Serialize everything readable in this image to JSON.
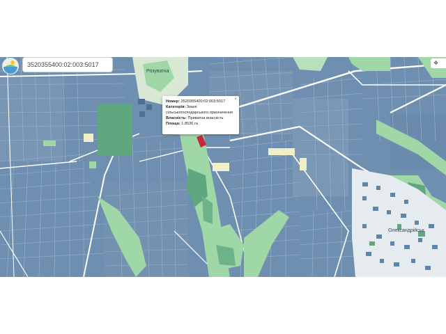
{
  "search": {
    "value": "3520355400:02:003:5017"
  },
  "popup": {
    "number_label": "Номер:",
    "number_value": "3520355400:02:003:5017",
    "category_label": "Категорія:",
    "category_value_1": "Землі",
    "category_value_2": "сільськогосподарського призначення",
    "ownership_label": "Власність:",
    "ownership_value": "Приватна власність",
    "area_label": "Площа:",
    "area_value": "1.8536 га",
    "close_glyph": "×"
  },
  "map_labels": {
    "village": "Розуватка",
    "town": "Олександрійськ"
  },
  "controls": {
    "layers_glyph": "❖"
  },
  "colors": {
    "parcel_blue": "#6f8fb0",
    "parcel_light": "#7f9dbb",
    "road": "#ffffff",
    "green": "#9fd8a6",
    "green_dark": "#5fa77e",
    "selected_parcel": "#c8283c",
    "yellow": "#f1efc8",
    "town_bg": "#e6ebef"
  }
}
